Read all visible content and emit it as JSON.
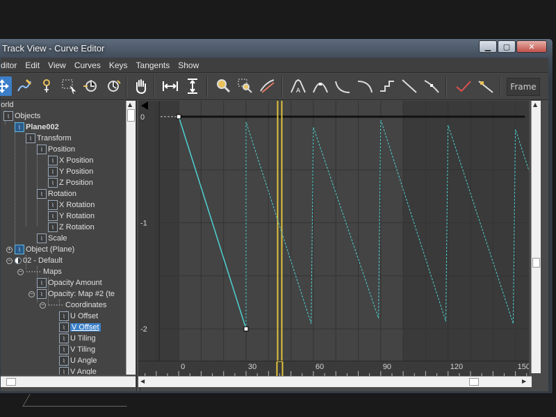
{
  "window": {
    "title": "Track View - Curve Editor",
    "minimize": "▁",
    "restore": "▢",
    "close": "✕"
  },
  "menu": [
    "ditor",
    "Edit",
    "View",
    "Curves",
    "Keys",
    "Tangents",
    "Show"
  ],
  "toolbar": {
    "frame_label": "Frame",
    "icons": [
      "move-keys-icon",
      "draw-curves-icon",
      "add-keys-icon",
      "region-select-icon",
      "retime-icon",
      "retime-all-icon",
      "pan-icon",
      "fit-horizontal-icon",
      "fit-vertical-icon",
      "zoom-icon",
      "zoom-region-icon",
      "isolate-curve-icon",
      "tangent-auto-icon",
      "tangent-spline-icon",
      "tangent-fast-icon",
      "tangent-slow-icon",
      "tangent-step-icon",
      "tangent-linear-icon",
      "tangent-smooth-icon",
      "show-tangents-icon",
      "lock-tangents-icon"
    ],
    "accent": "#3c7fc8"
  },
  "tree": [
    {
      "label": "World",
      "depth": 0
    },
    {
      "label": "Objects",
      "depth": 1
    },
    {
      "label": "Plane002",
      "depth": 2,
      "bold": true
    },
    {
      "label": "Transform",
      "depth": 3
    },
    {
      "label": "Position",
      "depth": 4
    },
    {
      "label": "X Position",
      "depth": 5
    },
    {
      "label": "Y Position",
      "depth": 5
    },
    {
      "label": "Z Position",
      "depth": 5
    },
    {
      "label": "Rotation",
      "depth": 4
    },
    {
      "label": "X Rotation",
      "depth": 5
    },
    {
      "label": "Y Rotation",
      "depth": 5
    },
    {
      "label": "Z Rotation",
      "depth": 5
    },
    {
      "label": "Scale",
      "depth": 4
    },
    {
      "label": "Object (Plane)",
      "depth": 2
    },
    {
      "label": "02 - Default",
      "depth": 2
    },
    {
      "label": "Maps",
      "depth": 3
    },
    {
      "label": "Opacity Amount",
      "depth": 4
    },
    {
      "label": "Opacity: Map #2 (te",
      "depth": 4
    },
    {
      "label": "Coordinates",
      "depth": 5
    },
    {
      "label": "U Offset",
      "depth": 6
    },
    {
      "label": "V Offset",
      "depth": 6,
      "selected": true
    },
    {
      "label": "U Tiling",
      "depth": 6
    },
    {
      "label": "V Tiling",
      "depth": 6
    },
    {
      "label": "U Angle",
      "depth": 6
    },
    {
      "label": "V Angle",
      "depth": 6
    }
  ],
  "chart_data": {
    "type": "line",
    "x_ticks": [
      "0",
      "30",
      "60",
      "90",
      "120",
      "150"
    ],
    "y_ticks": [
      "0",
      "-1",
      "-2"
    ],
    "xlim": [
      -18,
      156
    ],
    "ylim": [
      -2.3,
      0.15
    ],
    "current_frame": 45,
    "series": [
      {
        "key_points": [
          [
            0,
            0
          ],
          [
            30,
            -2
          ]
        ],
        "curve_color": "#4fd2d2"
      },
      {
        "out_of_range": [
          [
            30,
            -2
          ],
          [
            30,
            -0.05
          ],
          [
            59,
            -1.95
          ],
          [
            60,
            -0.1
          ],
          [
            89,
            -1.9
          ],
          [
            90,
            -0.03
          ],
          [
            119,
            -1.93
          ],
          [
            120,
            -0.08
          ],
          [
            149,
            -1.95
          ],
          [
            150,
            -0.12
          ],
          [
            159,
            -0.7
          ]
        ],
        "curve_color": "#4fd2d2"
      }
    ],
    "colors": {
      "background": "#3a3a3a",
      "active_range": "#444444",
      "time_slider": "#e0c23a",
      "zero_line": "#111111"
    }
  }
}
